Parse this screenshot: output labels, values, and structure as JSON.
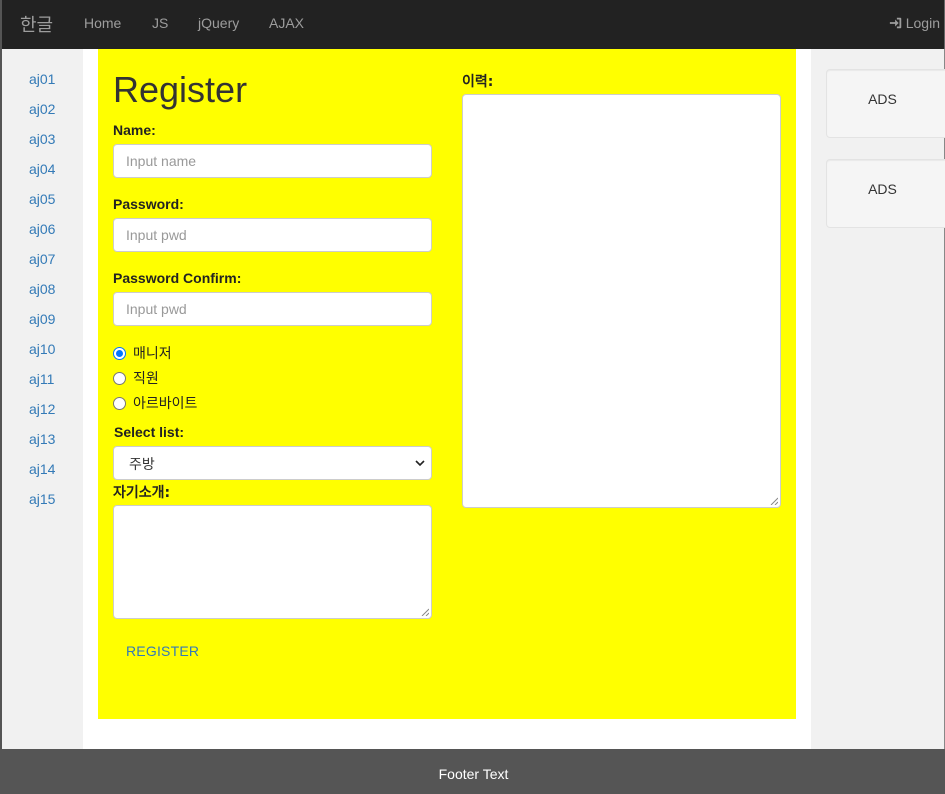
{
  "navbar": {
    "brand": "한글",
    "links": [
      "Home",
      "JS",
      "jQuery",
      "AJAX"
    ],
    "login_label": "Login",
    "login_icon": "log-in-icon"
  },
  "sidebar_left": {
    "items": [
      "aj01",
      "aj02",
      "aj03",
      "aj04",
      "aj05",
      "aj06",
      "aj07",
      "aj08",
      "aj09",
      "aj10",
      "aj11",
      "aj12",
      "aj13",
      "aj14",
      "aj15"
    ]
  },
  "form": {
    "title": "Register",
    "name_label": "Name:",
    "name_placeholder": "Input name",
    "password_label": "Password:",
    "password_placeholder": "Input pwd",
    "password_confirm_label": "Password Confirm:",
    "password_confirm_placeholder": "Input pwd",
    "roles": [
      {
        "label": "매니저",
        "checked": true
      },
      {
        "label": "직원",
        "checked": false
      },
      {
        "label": "아르바이트",
        "checked": false
      }
    ],
    "select_label": "Select list:",
    "select_value": "주방",
    "intro_label": "자기소개:",
    "history_label": "이력:",
    "register_label": "REGISTER"
  },
  "sidebar_right": {
    "ads": [
      "ADS",
      "ADS"
    ]
  },
  "footer": {
    "text": "Footer Text"
  },
  "colors": {
    "navbar_bg": "#222222",
    "panel_bg": "#ffff00",
    "link": "#337ab7",
    "footer_bg": "#555555",
    "radio_accent": "#0075ff"
  }
}
